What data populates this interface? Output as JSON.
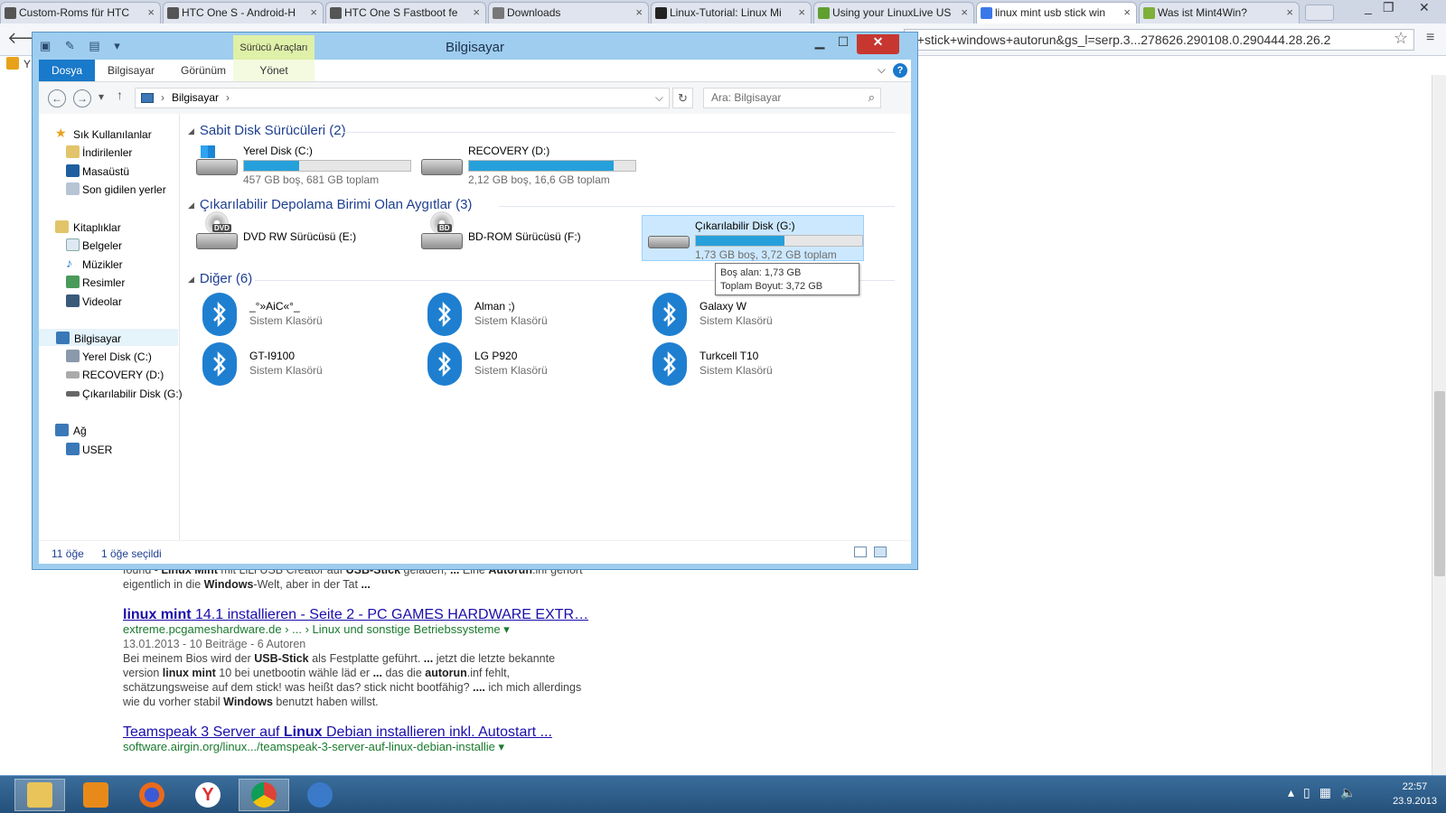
{
  "browser": {
    "tabs": [
      {
        "label": "Custom-Roms für HTC",
        "color": "#555555"
      },
      {
        "label": "HTC One S - Android-H",
        "color": "#555555"
      },
      {
        "label": "HTC One S Fastboot fe",
        "color": "#555555"
      },
      {
        "label": "Downloads",
        "color": "#777777"
      },
      {
        "label": "Linux-Tutorial: Linux Mi",
        "color": "#222222"
      },
      {
        "label": "Using your LinuxLive US",
        "color": "#5fa030"
      },
      {
        "label": "linux mint usb stick win",
        "color": "#3b78e7"
      },
      {
        "label": "Was ist Mint4Win?",
        "color": "#7fb03a"
      }
    ],
    "url": "p+stick+windows+autorun&gs_l=serp.3...278626.290108.0.290444.28.26.2",
    "bookmark_initial": "Y"
  },
  "results": {
    "snippet1": [
      {
        "t": "found - ",
        "b": false
      },
      {
        "t": "Linux Mint",
        "b": true
      },
      {
        "t": " mit LiLi USB Creator auf ",
        "b": false
      },
      {
        "t": "USB-Stick",
        "b": true
      },
      {
        "t": " geladen, ",
        "b": false
      },
      {
        "t": "...",
        "b": true
      },
      {
        "t": " Eine ",
        "b": false
      },
      {
        "t": "Autorun",
        "b": true
      },
      {
        "t": ".inf gehört eigentlich in die ",
        "b": false
      },
      {
        "t": "Windows",
        "b": true
      },
      {
        "t": "-Welt, aber in der Tat ",
        "b": false
      },
      {
        "t": "...",
        "b": true
      }
    ],
    "r2_title_pre": "linux mint",
    "r2_title_post": " 14.1 installieren - Seite 2 - PC GAMES HARDWARE EXTR…",
    "r2_url": "extreme.pcgameshardware.de › ... › Linux und sonstige Betriebssysteme ▾",
    "r2_meta": "13.01.2013 - 10 Beiträge - 6 Autoren",
    "r2_snippet": [
      {
        "t": "Bei meinem Bios wird der ",
        "b": false
      },
      {
        "t": "USB-Stick",
        "b": true
      },
      {
        "t": " als Festplatte geführt. ",
        "b": false
      },
      {
        "t": "...",
        "b": true
      },
      {
        "t": " jetzt die letzte bekannte version ",
        "b": false
      },
      {
        "t": "linux mint",
        "b": true
      },
      {
        "t": " 10 bei unetbootin wähle läd er ",
        "b": false
      },
      {
        "t": "...",
        "b": true
      },
      {
        "t": " das die ",
        "b": false
      },
      {
        "t": "autorun",
        "b": true
      },
      {
        "t": ".inf fehlt, schätzungsweise auf dem stick! was heißt das? stick nicht bootfähig? ",
        "b": false
      },
      {
        "t": "....",
        "b": true
      },
      {
        "t": " ich mich allerdings wie du vorher stabil ",
        "b": false
      },
      {
        "t": "Windows",
        "b": true
      },
      {
        "t": " benutzt haben willst.",
        "b": false
      }
    ],
    "r3_title_pre": "Teamspeak 3 Server auf ",
    "r3_title_bold": "Linux",
    "r3_title_post": " Debian installieren inkl. Autostart ...",
    "r3_url": "software.airgin.org/linux.../teamspeak-3-server-auf-linux-debian-installie ▾"
  },
  "explorer": {
    "title": "Bilgisayar",
    "context_tab": "Sürücü Araçları",
    "ribbon_tabs": {
      "file": "Dosya",
      "computer": "Bilgisayar",
      "view": "Görünüm",
      "manage": "Yönet"
    },
    "address": "Bilgisayar",
    "search_placeholder": "Ara: Bilgisayar",
    "nav": {
      "favorites": "Sık Kullanılanlar",
      "downloads": "İndirilenler",
      "desktop": "Masaüstü",
      "recent": "Son gidilen yerler",
      "libraries": "Kitaplıklar",
      "documents": "Belgeler",
      "music": "Müzikler",
      "pictures": "Resimler",
      "videos": "Videolar",
      "computer": "Bilgisayar",
      "local_disk": "Yerel Disk (C:)",
      "recovery": "RECOVERY (D:)",
      "removable": "Çıkarılabilir Disk (G:)",
      "network": "Ağ",
      "user": "USER"
    },
    "groups": {
      "hdd": "Sabit Disk Sürücüleri (2)",
      "removable": "Çıkarılabilir Depolama Birimi Olan Aygıtlar (3)",
      "other": "Diğer (6)"
    },
    "drives": {
      "c": {
        "name": "Yerel Disk (C:)",
        "info": "457 GB boş, 681 GB toplam",
        "used_fraction": 0.33
      },
      "d": {
        "name": "RECOVERY (D:)",
        "info": "2,12 GB boş, 16,6 GB toplam",
        "used_fraction": 0.87
      },
      "e": {
        "name": "DVD RW Sürücüsü (E:)",
        "tag": "DVD"
      },
      "f": {
        "name": "BD-ROM Sürücüsü (F:)",
        "tag": "BD"
      },
      "g": {
        "name": "Çıkarılabilir Disk (G:)",
        "info": "1,73 GB boş, 3,72 GB toplam",
        "used_fraction": 0.53
      }
    },
    "devices": [
      {
        "name": "_°»AiC«°_",
        "sub": "Sistem Klasörü"
      },
      {
        "name": "Alman ;)",
        "sub": "Sistem Klasörü"
      },
      {
        "name": "Galaxy W",
        "sub": "Sistem Klasörü"
      },
      {
        "name": "GT-I9100",
        "sub": "Sistem Klasörü"
      },
      {
        "name": "LG P920",
        "sub": "Sistem Klasörü"
      },
      {
        "name": "Turkcell T10",
        "sub": "Sistem Klasörü"
      }
    ],
    "tooltip": {
      "free": "Boş alan: 1,73 GB",
      "total": "Toplam Boyut: 3,72 GB"
    },
    "status": {
      "count": "11 öğe",
      "selected": "1 öğe seçildi"
    }
  },
  "taskbar": {
    "time": "22:57",
    "date": "23.9.2013"
  }
}
